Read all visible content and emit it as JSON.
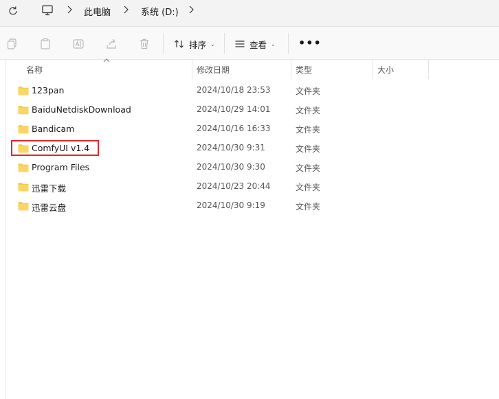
{
  "address": {
    "crumbs": [
      "此电脑",
      "系统 (D:)"
    ]
  },
  "toolbar": {
    "sort_label": "排序",
    "view_label": "查看",
    "more_label": "•••"
  },
  "columns": {
    "name": "名称",
    "modified": "修改日期",
    "type": "类型",
    "size": "大小"
  },
  "files": [
    {
      "name": "123pan",
      "modified": "2024/10/18 23:53",
      "type": "文件夹"
    },
    {
      "name": "BaiduNetdiskDownload",
      "modified": "2024/10/29 14:01",
      "type": "文件夹"
    },
    {
      "name": "Bandicam",
      "modified": "2024/10/16 16:33",
      "type": "文件夹"
    },
    {
      "name": "ComfyUI v1.4",
      "modified": "2024/10/30 9:31",
      "type": "文件夹"
    },
    {
      "name": "Program Files",
      "modified": "2024/10/30 9:30",
      "type": "文件夹"
    },
    {
      "name": "迅雷下载",
      "modified": "2024/10/23 20:44",
      "type": "文件夹"
    },
    {
      "name": "迅雷云盘",
      "modified": "2024/10/30 9:19",
      "type": "文件夹"
    }
  ],
  "colors": {
    "folder": "#f7c948",
    "highlight": "#e0282e"
  }
}
